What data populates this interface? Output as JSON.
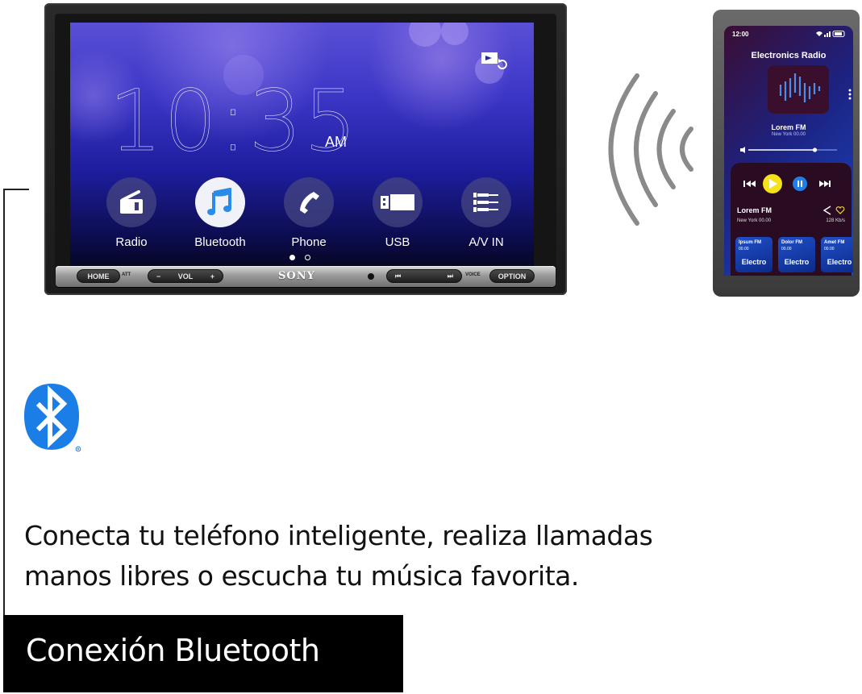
{
  "head_unit": {
    "brand": "SONY",
    "clock": {
      "time": "10:35",
      "period": "AM"
    },
    "cast_icon": "screen-mirroring-icon",
    "apps": [
      {
        "label": "Radio",
        "icon": "radio-icon",
        "active": false
      },
      {
        "label": "Bluetooth",
        "icon": "music-note-icon",
        "active": true
      },
      {
        "label": "Phone",
        "icon": "phone-handset-icon",
        "active": false
      },
      {
        "label": "USB",
        "icon": "usb-drive-icon",
        "active": false
      },
      {
        "label": "A/V IN",
        "icon": "av-cables-icon",
        "active": false
      }
    ],
    "page_indicator": {
      "pages": 2,
      "current": 1
    },
    "buttons": {
      "home": "HOME",
      "att": "ATT",
      "vol_minus": "−",
      "vol": "VOL",
      "vol_plus": "+",
      "prev": "⏮",
      "next": "⏭",
      "voice": "VOICE",
      "option": "OPTION"
    }
  },
  "wireless_icon": "wireless-signal-icon",
  "phone": {
    "status_time": "12:00",
    "app_title": "Electronics Radio",
    "station": "Lorem FM",
    "station_sub": "New York 00.00",
    "volume_level": 0.75,
    "now_playing": {
      "name": "Lorem FM",
      "city": "New York 00.00",
      "bitrate": "128 Kb/s"
    },
    "cards": [
      {
        "name": "Ipsum FM",
        "time": "00.00",
        "genre": "Electro"
      },
      {
        "name": "Dolor FM",
        "time": "00.00",
        "genre": "Electro"
      },
      {
        "name": "Amet FM",
        "time": "00.00",
        "genre": "Electro"
      }
    ]
  },
  "bluetooth_logo": "bluetooth-icon",
  "description": {
    "line1": "Conecta tu teléfono inteligente, realiza llamadas",
    "line2": "manos libres o escucha tu música favorita."
  },
  "caption": "Conexión Bluetooth",
  "colors": {
    "bluetooth_blue": "#1a7ee6",
    "play_yellow": "#f5e21a",
    "pause_blue": "#1f7ee8",
    "heart_yellow": "#f2d53c",
    "caption_bg": "#000000"
  }
}
